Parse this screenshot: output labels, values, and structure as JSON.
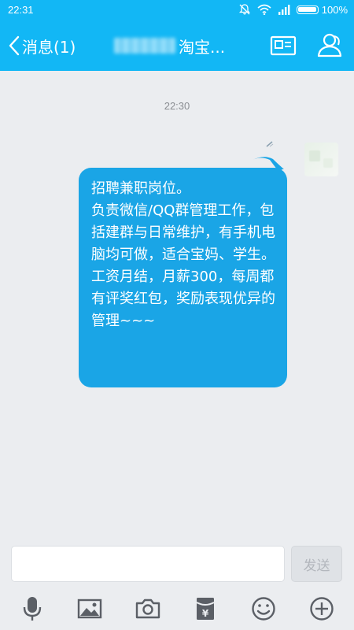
{
  "status_bar": {
    "time": "22:31",
    "battery": "100%"
  },
  "nav": {
    "back_label": "消息(1)",
    "title_suffix": "淘宝..."
  },
  "chat": {
    "timestamp": "22:30",
    "message": "招聘兼职岗位。\n负责微信/QQ群管理工作，包括建群与日常维护，有手机电脑均可做，适合宝妈、学生。\n工资月结，月薪300，每周都有评奖红包，奖励表现优异的管理~~~"
  },
  "input": {
    "placeholder": "",
    "send_label": "发送"
  },
  "icons": {
    "nav_card": "profile-card-icon",
    "nav_person": "contact-person-icon",
    "toolbar": [
      "microphone-icon",
      "image-icon",
      "camera-icon",
      "red-packet-icon",
      "emoji-icon",
      "plus-icon"
    ]
  },
  "colors": {
    "accent": "#12b7f5",
    "bubble": "#1aa5e6",
    "background": "#ebedf0"
  }
}
